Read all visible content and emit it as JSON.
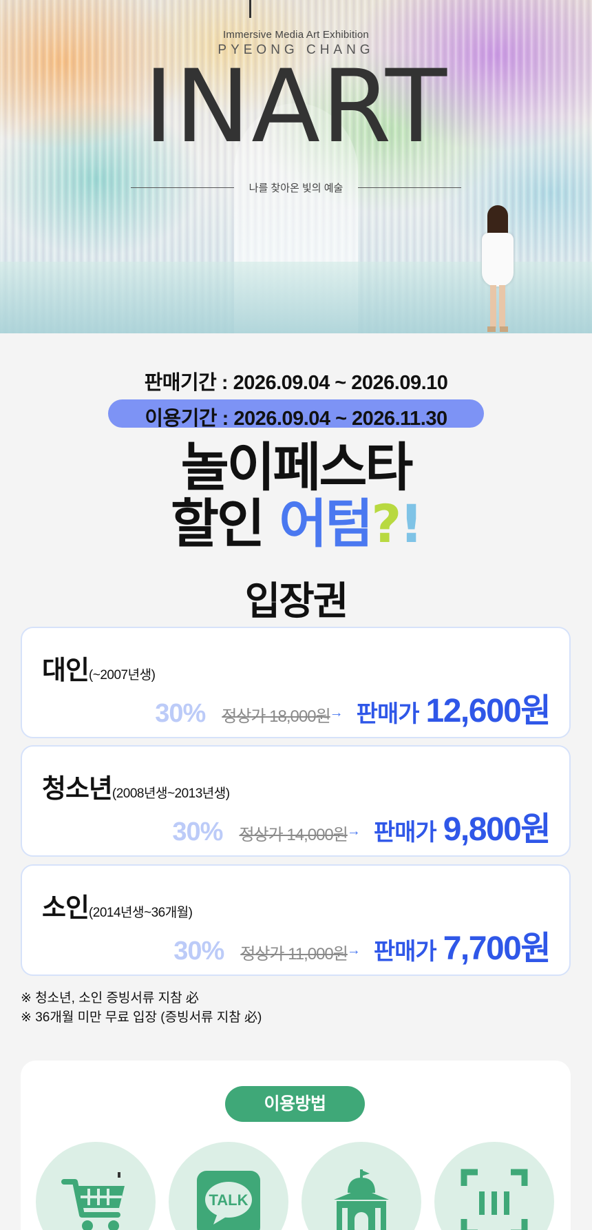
{
  "hero": {
    "subtitle": "Immersive Media Art Exhibition",
    "city": "PYEONG CHANG",
    "logo": "INART",
    "tagline": "나를 찾아온 빛의 예술"
  },
  "periods": {
    "sale": "판매기간 : 2026.09.04 ~ 2026.09.10",
    "use": "이용기간 : 2026.09.04 ~ 2026.11.30"
  },
  "headline": {
    "line1": "놀이페스타",
    "line2_black": "할인 ",
    "line2_blue": "어텀",
    "line2_q": "?",
    "line2_ex": "!"
  },
  "section_title": "입장권",
  "tickets": [
    {
      "name": "대인",
      "range": "(~2007년생)",
      "discount": "30%",
      "original": "정상가 18,000원",
      "label": "판매가",
      "price": "12,600원"
    },
    {
      "name": "청소년",
      "range": "(2008년생~2013년생)",
      "discount": "30%",
      "original": "정상가 14,000원",
      "label": "판매가",
      "price": "9,800원"
    },
    {
      "name": "소인",
      "range": "(2014년생~36개월)",
      "discount": "30%",
      "original": "정상가 11,000원",
      "label": "판매가",
      "price": "7,700원"
    }
  ],
  "notes": [
    "※ 청소년, 소인 증빙서류 지참 必",
    "※ 36개월 미만 무료 입장 (증빙서류 지참 必)"
  ],
  "usage": {
    "title": "이용방법",
    "steps": [
      {
        "icon": "shopping-cart-icon"
      },
      {
        "icon": "kakaotalk-icon",
        "text": "TALK"
      },
      {
        "icon": "museum-building-icon"
      },
      {
        "icon": "barcode-scan-icon"
      }
    ]
  },
  "colors": {
    "accent_blue": "#2f57e8",
    "pill_blue": "#7d93f5",
    "discount_light": "#bccbf8",
    "green": "#3fa878",
    "step_bg": "#dcefe6"
  }
}
